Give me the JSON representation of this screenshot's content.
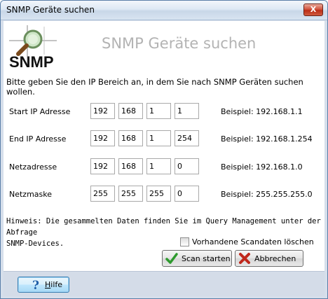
{
  "window": {
    "title": "SNMP Geräte suchen",
    "close_glyph": "X"
  },
  "header": {
    "logo_text": "SNMP",
    "title": "SNMP Geräte suchen"
  },
  "instruction": "Bitte geben Sie den IP Bereich an, in dem Sie nach SNMP Geräten suchen wollen.",
  "rows": [
    {
      "label": "Start IP Adresse",
      "octets": [
        "192",
        "168",
        "1",
        "1"
      ],
      "example": "Beispiel: 192.168.1.1"
    },
    {
      "label": "End IP Adresse",
      "octets": [
        "192",
        "168",
        "1",
        "254"
      ],
      "example": "Beispiel: 192.168.1.254"
    },
    {
      "label": "Netzadresse",
      "octets": [
        "192",
        "168",
        "1",
        "0"
      ],
      "example": "Beispiel: 192.168.1.0"
    },
    {
      "label": "Netzmaske",
      "octets": [
        "255",
        "255",
        "255",
        "0"
      ],
      "example": "Beispiel: 255.255.255.0"
    }
  ],
  "hint_line1": "Hinweis: Die gesammelten Daten finden Sie im Query Management unter der Abfrage",
  "hint_line2": "SNMP-Devices.",
  "checkbox": {
    "label": "Vorhandene Scandaten löschen",
    "checked": false
  },
  "buttons": {
    "scan": "Scan starten",
    "cancel": "Abbrechen",
    "help": "Hilfe"
  },
  "icons": {
    "logo": "snmp-magnifier-logo",
    "scan": "green-checkmark-icon",
    "cancel": "red-x-icon",
    "help": "question-mark-icon"
  },
  "colors": {
    "title_gray": "#b3b3b3",
    "check_green": "#2e9a2e",
    "cancel_red": "#c0281c",
    "help_blue": "#1f5fa8"
  }
}
